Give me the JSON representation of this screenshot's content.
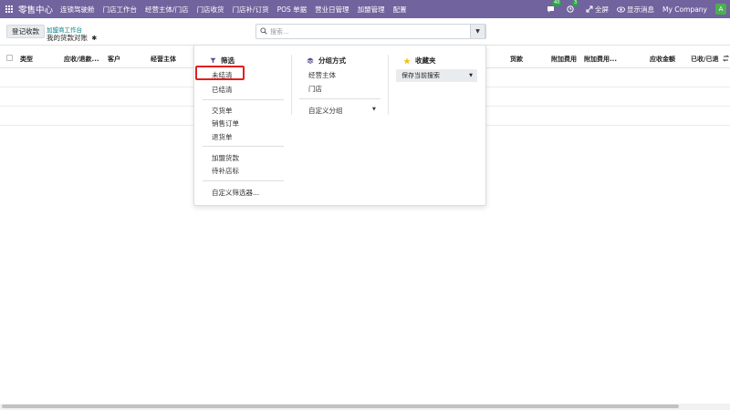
{
  "navbar": {
    "brand": "零售中心",
    "menu": [
      "连锁驾驶舱",
      "门店工作台",
      "经营主体/门店",
      "门店收货",
      "门店补/订货",
      "POS 单据",
      "营业日管理",
      "加盟管理",
      "配置"
    ],
    "systray": {
      "messages_count": "40",
      "activities_count": "3",
      "fullscreen_label": "全屏",
      "show_messages_label": "显示消息",
      "company": "My Company",
      "avatar_letter": "A"
    }
  },
  "control_panel": {
    "register_button": "登记收款",
    "breadcrumb": "加盟商工作台",
    "page_title": "我的货款对账",
    "search_placeholder": "搜索..."
  },
  "list": {
    "columns": [
      "类型",
      "应收/退款...",
      "客户",
      "经营主体",
      "货款",
      "附加费用",
      "附加费用...",
      "应收金额",
      "已收/已退"
    ]
  },
  "dropdown": {
    "filters": {
      "title": "筛选",
      "items": [
        "未结清",
        "已结清",
        "交货单",
        "销售订单",
        "退货单",
        "加盟货款",
        "待补店标",
        "自定义筛选器..."
      ]
    },
    "group_by": {
      "title": "分组方式",
      "items": [
        "经营主体",
        "门店"
      ],
      "custom_group": "自定义分组"
    },
    "favorites": {
      "title": "收藏夹",
      "save_search": "保存当前搜索"
    }
  },
  "colors": {
    "navbar": "#71639e",
    "highlight": "#e02020",
    "link": "#017e84"
  }
}
